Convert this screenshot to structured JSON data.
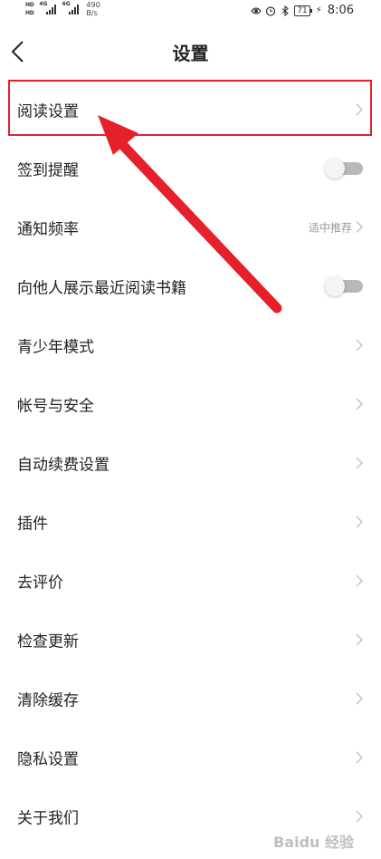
{
  "status_bar": {
    "hd1": "HD",
    "hd2": "HD",
    "net1": "4G",
    "net2": "4G",
    "speed_value": "490",
    "speed_unit": "B/s",
    "battery": "71",
    "time": "8:06",
    "icons": [
      "eye-icon",
      "alarm-icon",
      "bluetooth-icon",
      "battery-icon",
      "charging-icon"
    ]
  },
  "header": {
    "title": "设置",
    "back_icon": "chevron-left-icon"
  },
  "settings": {
    "items": [
      {
        "label": "阅读设置",
        "control": "chevron"
      },
      {
        "label": "签到提醒",
        "control": "toggle",
        "on": false
      },
      {
        "label": "通知频率",
        "control": "chevron",
        "value": "适中推荐"
      },
      {
        "label": "向他人展示最近阅读书籍",
        "control": "toggle",
        "on": false
      },
      {
        "label": "青少年模式",
        "control": "chevron"
      },
      {
        "label": "帐号与安全",
        "control": "chevron"
      },
      {
        "label": "自动续费设置",
        "control": "chevron"
      },
      {
        "label": "插件",
        "control": "chevron"
      },
      {
        "label": "去评价",
        "control": "chevron"
      },
      {
        "label": "检查更新",
        "control": "chevron"
      },
      {
        "label": "清除缓存",
        "control": "chevron"
      },
      {
        "label": "隐私设置",
        "control": "chevron"
      },
      {
        "label": "关于我们",
        "control": "chevron"
      }
    ]
  },
  "annotation": {
    "highlight_color": "#e5202b",
    "arrow_color": "#e5202b"
  },
  "watermark": {
    "text": "Baidu 经验"
  },
  "colors": {
    "text": "#222222",
    "secondary": "#999999",
    "chevron": "#c0c0c0",
    "toggle_off": "#b8b8b8"
  }
}
